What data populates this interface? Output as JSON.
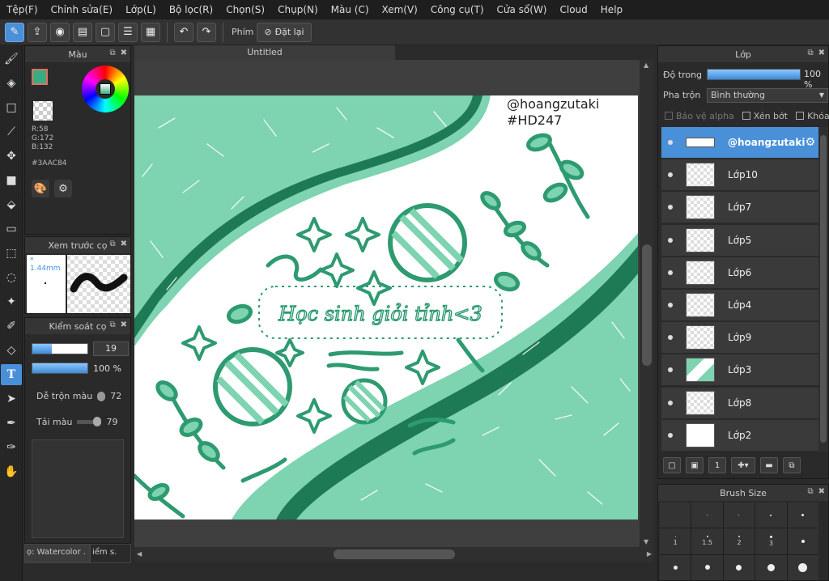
{
  "menu": [
    "Tệp(F)",
    "Chỉnh sửa(E)",
    "Lớp(L)",
    "Bộ lọc(R)",
    "Chọn(S)",
    "Chụp(N)",
    "Màu (C)",
    "Xem(V)",
    "Công cụ(T)",
    "Cửa sổ(W)",
    "Cloud",
    "Help"
  ],
  "toolbar": {
    "shortcut_label": "Phím",
    "reset_label": "Đặt lại"
  },
  "color_panel": {
    "title": "Màu",
    "rgb_r": "R:58",
    "rgb_g": "G:172",
    "rgb_b": "B:132",
    "hex": "#3AAC84",
    "main_color": "#3AAC84",
    "sub_color": "#E07060"
  },
  "preview_panel": {
    "title": "Xem trước cọ",
    "size": "1.44mm"
  },
  "brush_panel": {
    "title": "Kiểm soát cọ",
    "size": {
      "value": "19",
      "fraction": 0.35
    },
    "opacity": {
      "value": "100 %",
      "fraction": 1.0
    },
    "blend_label": "Dễ trộn màu",
    "blend_value": "72",
    "color_load_label": "Tải màu",
    "color_load_value": "79"
  },
  "bottom_tabs": [
    "ọ: Watercolor .",
    "iểm s."
  ],
  "document": {
    "title": "Untitled"
  },
  "artwork": {
    "watermark_name": "@hoangzutaki",
    "watermark_tag": "#HD247",
    "caption": "Học sinh giỏi tỉnh<3",
    "colors": {
      "light": "#7ED3B0",
      "dark": "#1E7A55",
      "mid": "#3AAC84"
    }
  },
  "layer_panel": {
    "title": "Lớp",
    "opacity_label": "Độ trong",
    "opacity_value": "100 %",
    "blend_label": "Pha trộn",
    "blend_value": "Bình thường",
    "protect_alpha": "Bảo vệ alpha",
    "clip": "Xén bớt",
    "lock": "Khóa",
    "layers": [
      {
        "name": "@hoangzutaki",
        "selected": true,
        "thumb": "banner"
      },
      {
        "name": "Lớp10",
        "thumb": "checker"
      },
      {
        "name": "Lớp7",
        "thumb": "checker"
      },
      {
        "name": "Lớp5",
        "thumb": "checker"
      },
      {
        "name": "Lớp6",
        "thumb": "checker"
      },
      {
        "name": "Lớp4",
        "thumb": "checker"
      },
      {
        "name": "Lớp9",
        "thumb": "checker"
      },
      {
        "name": "Lớp3",
        "thumb": "green"
      },
      {
        "name": "Lớp8",
        "thumb": "checker"
      },
      {
        "name": "Lớp2",
        "thumb": "white"
      }
    ]
  },
  "brush_size_panel": {
    "title": "Brush Size",
    "sizes": [
      "1",
      "1.5",
      "2",
      "3"
    ]
  }
}
